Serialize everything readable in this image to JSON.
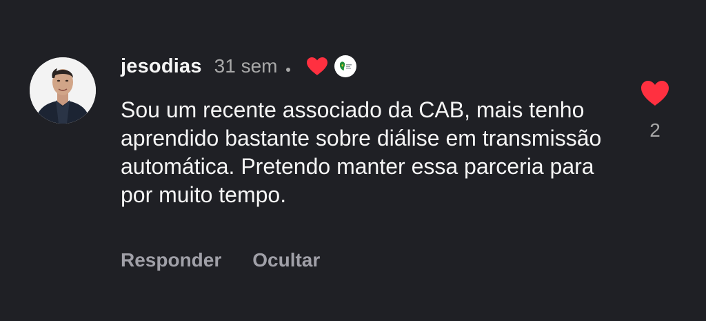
{
  "comment": {
    "username": "jesodias",
    "time_ago": "31 sem",
    "text": "Sou um recente associado da CAB, mais tenho aprendido bastante sobre diálise em transmissão automática. Pretendo manter essa parceria para por muito tempo.",
    "reply_label": "Responder",
    "hide_label": "Ocultar",
    "like_count": "2",
    "liked_by_author": true
  },
  "icons": {
    "author_like": "heart-icon",
    "creator_badge": "profile-badge-icon",
    "like": "heart-icon"
  },
  "colors": {
    "background": "#1f2025",
    "heart": "#ff3040",
    "text_primary": "#f5f5f5",
    "text_secondary": "#a8a8a8"
  }
}
